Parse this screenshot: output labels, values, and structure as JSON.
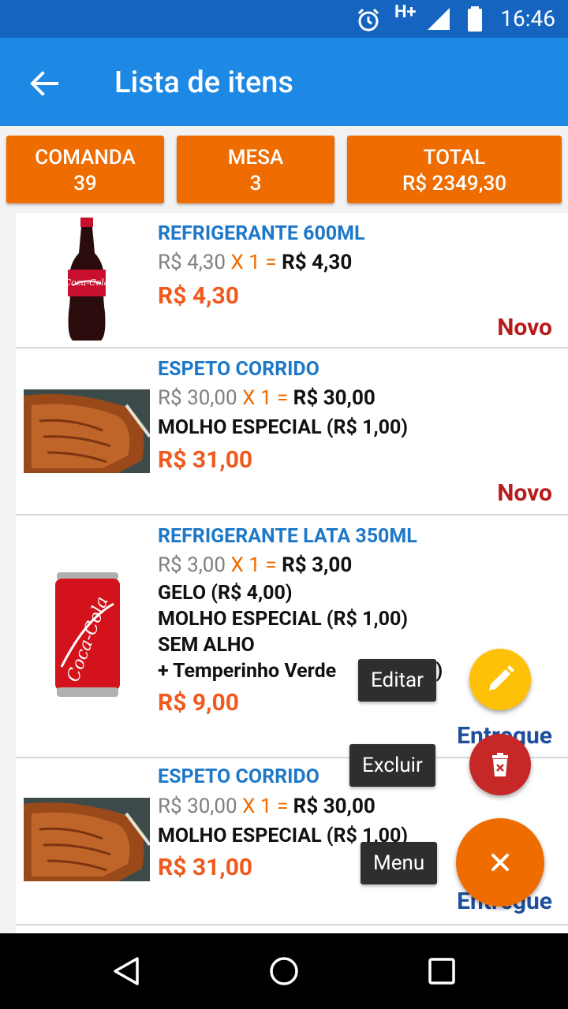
{
  "status_bar": {
    "time": "16:46",
    "network": "H+"
  },
  "app_bar": {
    "title": "Lista de itens"
  },
  "summary": {
    "comanda_label": "COMANDA",
    "comanda_value": "39",
    "mesa_label": "MESA",
    "mesa_value": "3",
    "total_label": "TOTAL",
    "total_value": "R$ 2349,30"
  },
  "items": [
    {
      "name": "REFRIGERANTE 600ML",
      "unit_price": "R$ 4,30",
      "qty": "X 1",
      "eq": "=",
      "subtotal": "R$ 4,30",
      "extras": [],
      "total": "R$ 4,30",
      "status": "Novo",
      "status_color": "#b71c1c",
      "image": "coca-cola-bottle"
    },
    {
      "name": "ESPETO CORRIDO",
      "unit_price": "R$ 30,00",
      "qty": "X 1",
      "eq": "=",
      "subtotal": "R$ 30,00",
      "extras": [
        "MOLHO ESPECIAL (R$ 1,00)"
      ],
      "total": "R$ 31,00",
      "status": "Novo",
      "status_color": "#b71c1c",
      "image": "grilled-meat"
    },
    {
      "name": "REFRIGERANTE LATA 350ML",
      "unit_price": "R$ 3,00",
      "qty": "X 1",
      "eq": "=",
      "subtotal": "R$ 3,00",
      "extras": [
        "GELO (R$ 4,00)",
        "MOLHO ESPECIAL (R$ 1,00)",
        "SEM ALHO",
        "+ Temperinho Verde"
      ],
      "extras_tail": "0)",
      "total": "R$ 9,00",
      "status": "Entregue",
      "status_color": "#1e4f9c",
      "image": "coca-cola-can"
    },
    {
      "name": "ESPETO CORRIDO",
      "unit_price": "R$ 30,00",
      "qty": "X 1",
      "eq": "=",
      "subtotal": "R$ 30,00",
      "extras": [
        "MOLHO ESPECIAL (R$ 1,00)"
      ],
      "total": "R$ 31,00",
      "status": "Entregue",
      "status_color": "#1e4f9c",
      "image": "grilled-meat"
    }
  ],
  "fab_menu": {
    "edit_label": "Editar",
    "edit_color": "#ffc107",
    "delete_label": "Excluir",
    "delete_color": "#c62828",
    "menu_label": "Menu",
    "menu_color": "#ef6c00"
  },
  "colors": {
    "primary": "#1e88e5",
    "primary_dark": "#1565c0",
    "accent": "#ef6c00",
    "item_name": "#1e78c8",
    "price": "#f05a1e"
  }
}
